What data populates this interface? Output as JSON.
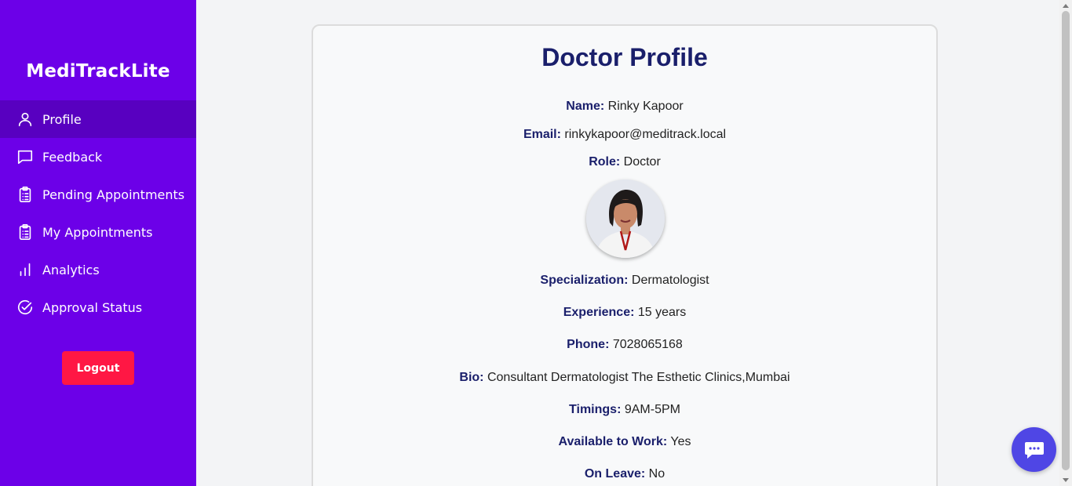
{
  "sidebar": {
    "brand": "MediTrackLite",
    "items": [
      {
        "label": "Profile",
        "icon": "user-icon",
        "active": true
      },
      {
        "label": "Feedback",
        "icon": "message-square-icon",
        "active": false
      },
      {
        "label": "Pending Appointments",
        "icon": "clipboard-list-icon",
        "active": false
      },
      {
        "label": "My Appointments",
        "icon": "clipboard-list-icon",
        "active": false
      },
      {
        "label": "Analytics",
        "icon": "bar-chart-icon",
        "active": false
      },
      {
        "label": "Approval Status",
        "icon": "check-circle-icon",
        "active": false
      }
    ],
    "logout_label": "Logout"
  },
  "profile": {
    "title": "Doctor Profile",
    "name_label": "Name:",
    "name": "Rinky Kapoor",
    "email_label": "Email:",
    "email": "rinkykapoor@meditrack.local",
    "role_label": "Role:",
    "role": "Doctor",
    "specialization_label": "Specialization:",
    "specialization": "Dermatologist",
    "experience_label": "Experience:",
    "experience": "15 years",
    "phone_label": "Phone:",
    "phone": "7028065168",
    "bio_label": "Bio:",
    "bio": "Consultant Dermatologist The Esthetic Clinics,Mumbai",
    "timings_label": "Timings:",
    "timings": "9AM-5PM",
    "available_label": "Available to Work:",
    "available": "Yes",
    "leave_label": "On Leave:",
    "leave": "No"
  },
  "colors": {
    "sidebar_bg": "#6c00e8",
    "sidebar_active": "#5800c0",
    "logout_bg": "#ff1744",
    "heading": "#1a1f6b",
    "chat_bg": "#4f46e5"
  },
  "chat": {
    "icon": "chat-bubble-icon"
  }
}
